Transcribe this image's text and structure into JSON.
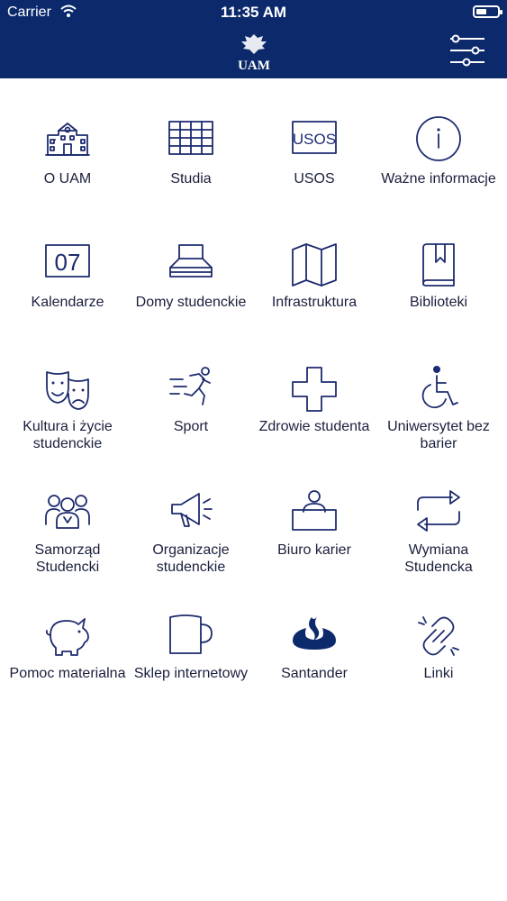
{
  "status_bar": {
    "carrier": "Carrier",
    "time": "11:35 AM"
  },
  "header": {
    "logo_icon": "uam-eagle-logo",
    "filter_icon": "sliders-icon"
  },
  "tiles": [
    {
      "label": "O UAM",
      "icon": "university-building-icon"
    },
    {
      "label": "Studia",
      "icon": "grid-table-icon"
    },
    {
      "label": "USOS",
      "icon": "usos-badge-icon"
    },
    {
      "label": "Ważne informacje",
      "icon": "info-circle-icon"
    },
    {
      "label": "Kalendarze",
      "icon": "calendar-07-icon"
    },
    {
      "label": "Domy studenckie",
      "icon": "bed-icon"
    },
    {
      "label": "Infrastruktura",
      "icon": "map-icon"
    },
    {
      "label": "Biblioteki",
      "icon": "book-icon"
    },
    {
      "label": "Kultura i życie studenckie",
      "icon": "theater-masks-icon"
    },
    {
      "label": "Sport",
      "icon": "runner-icon"
    },
    {
      "label": "Zdrowie studenta",
      "icon": "medical-cross-icon"
    },
    {
      "label": "Uniwersytet bez barier",
      "icon": "wheelchair-icon"
    },
    {
      "label": "Samorząd Studencki",
      "icon": "group-people-icon"
    },
    {
      "label": "Organizacje studenckie",
      "icon": "megaphone-icon"
    },
    {
      "label": "Biuro karier",
      "icon": "person-at-desk-icon"
    },
    {
      "label": "Wymiana Studencka",
      "icon": "exchange-arrows-icon"
    },
    {
      "label": "Pomoc materialna",
      "icon": "piggy-bank-icon"
    },
    {
      "label": "Sklep internetowy",
      "icon": "mug-icon"
    },
    {
      "label": "Santander",
      "icon": "santander-flame-icon"
    },
    {
      "label": "Linki",
      "icon": "chain-link-icon"
    }
  ]
}
